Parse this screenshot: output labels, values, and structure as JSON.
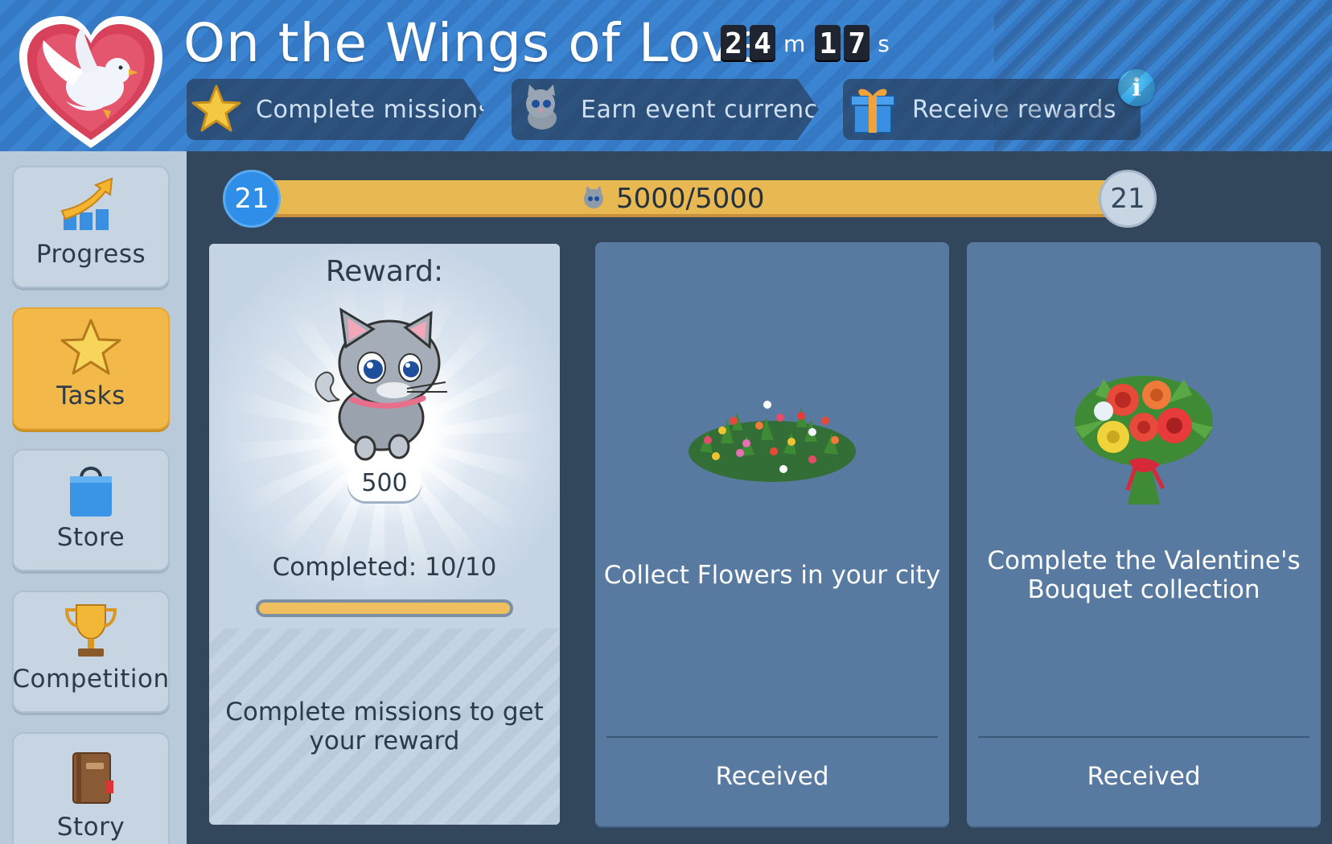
{
  "event": {
    "title": "On the Wings of Love",
    "timer": {
      "minutes": [
        "2",
        "4"
      ],
      "minutes_unit": "m",
      "seconds": [
        "1",
        "7"
      ],
      "seconds_unit": "s"
    },
    "logo_icon": "dove-heart-icon"
  },
  "steps": [
    {
      "label": "Complete missions",
      "icon": "star-icon"
    },
    {
      "label": "Earn event currency",
      "icon": "cat-currency-icon"
    },
    {
      "label": "Receive rewards",
      "icon": "gift-icon"
    }
  ],
  "info_label": "i",
  "sidebar": {
    "items": [
      {
        "label": "Progress",
        "icon": "progress-chart-icon",
        "active": false
      },
      {
        "label": "Tasks",
        "icon": "star-icon",
        "active": true
      },
      {
        "label": "Store",
        "icon": "shopping-bag-icon",
        "active": false
      },
      {
        "label": "Competition",
        "icon": "trophy-icon",
        "active": false
      },
      {
        "label": "Story",
        "icon": "book-icon",
        "active": false
      }
    ]
  },
  "progress": {
    "level_current": "21",
    "level_next": "21",
    "text": "5000/5000",
    "fraction": 1.0
  },
  "reward_card": {
    "label": "Reward:",
    "quantity": "500",
    "completed": "Completed: 10/10",
    "completed_fraction": 1.0,
    "hint": "Complete missions to get your reward"
  },
  "tasks": [
    {
      "description": "Collect Flowers in your city",
      "status": "Received",
      "image": "flower-field-icon"
    },
    {
      "description": "Complete the Valentine's Bouquet collection",
      "status": "Received",
      "image": "bouquet-icon"
    }
  ],
  "colors": {
    "accent": "#f2b84a",
    "header_blue": "#3a84d2",
    "card_blue": "#587aa0",
    "level_blue": "#2e8ee8"
  }
}
